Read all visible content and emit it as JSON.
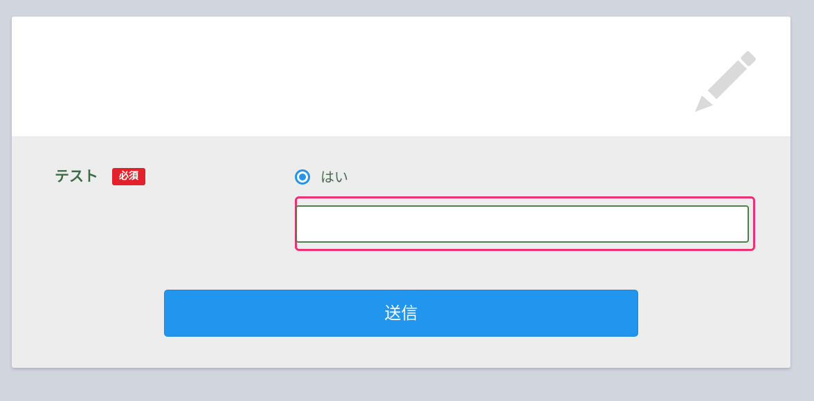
{
  "form": {
    "field_label": "テスト",
    "required_badge": "必須",
    "radio_option_label": "はい",
    "radio_selected": true,
    "text_input_value": "",
    "submit_label": "送信"
  },
  "icons": {
    "header_icon": "pencil-icon",
    "radio": "radio-selected-icon"
  },
  "colors": {
    "background": "#d1d5de",
    "card_body": "#ededed",
    "card_header": "#ffffff",
    "label_text": "#3b6b45",
    "required_badge": "#e4202a",
    "radio_accent": "#2394ea",
    "highlight_border": "#ef2f73",
    "input_border": "#4d8048",
    "submit_button": "#2295ee",
    "pencil_icon": "#dadada"
  }
}
